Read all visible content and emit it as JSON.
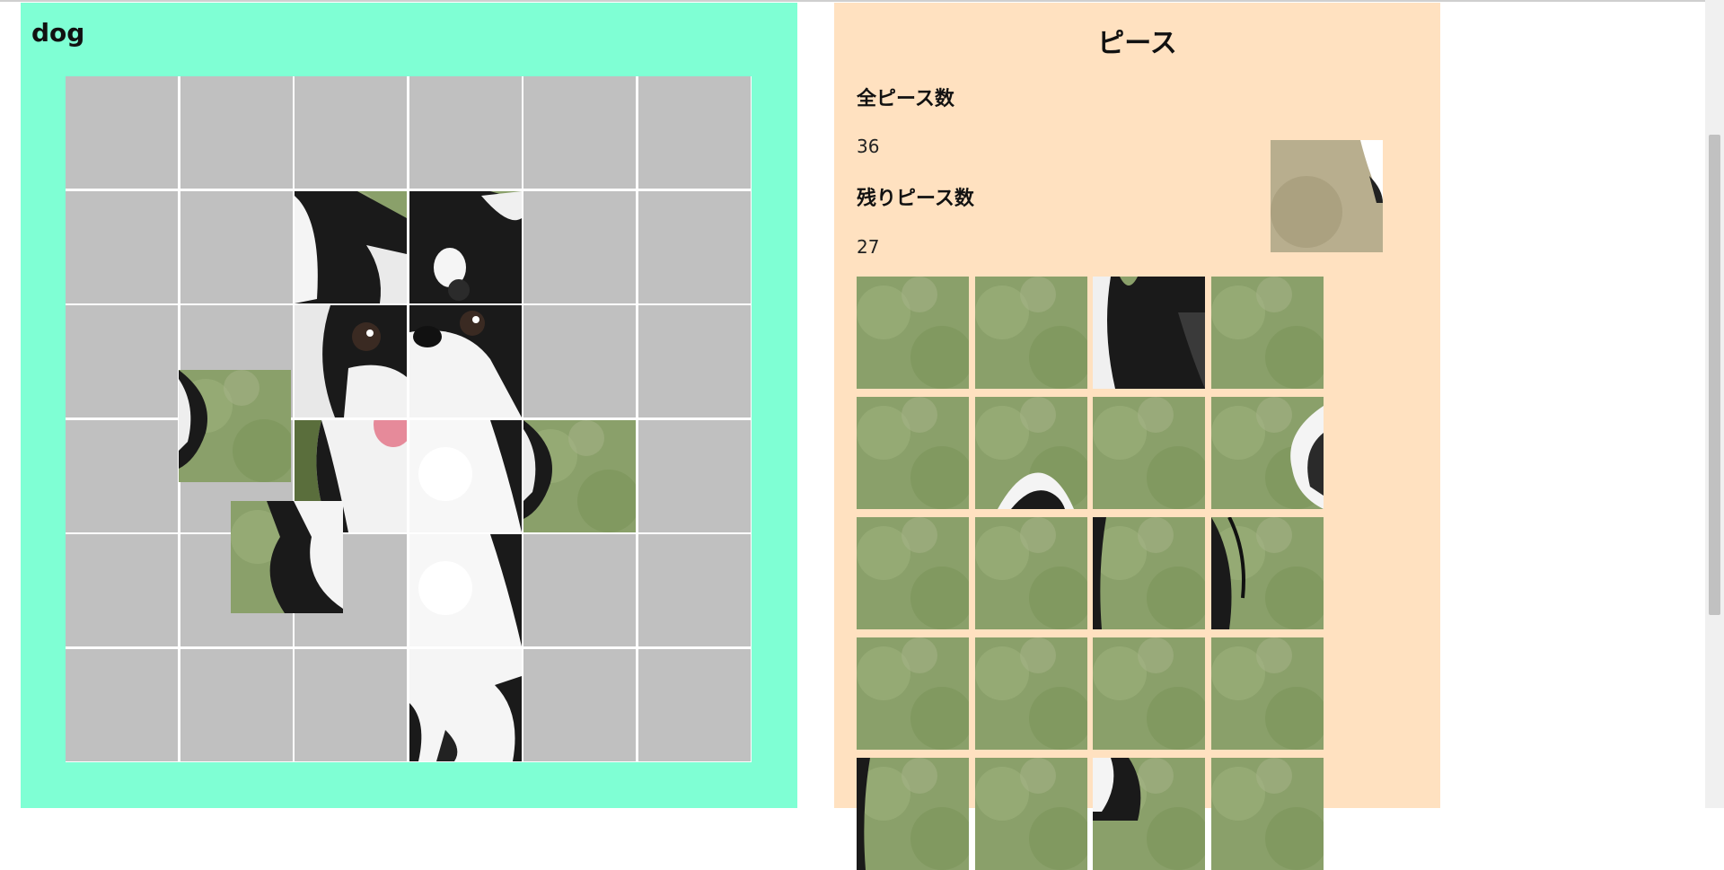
{
  "board": {
    "title": "dog",
    "grid": "6x6",
    "placed_pieces": [
      {
        "row": 1,
        "col": 2,
        "image": "dog-ear-left"
      },
      {
        "row": 1,
        "col": 3,
        "image": "dog-ear-right"
      },
      {
        "row": 2,
        "col": 2,
        "image": "dog-eye-left"
      },
      {
        "row": 2,
        "col": 3,
        "image": "dog-nose"
      },
      {
        "row": 3,
        "col": 2,
        "image": "dog-tongue-chest"
      },
      {
        "row": 3,
        "col": 3,
        "image": "dog-chest-white"
      },
      {
        "row": 3,
        "col": 4,
        "image": "dog-fur-edge-grass"
      },
      {
        "row": 4,
        "col": 3,
        "image": "dog-chest-white"
      },
      {
        "row": 5,
        "col": 3,
        "image": "dog-legs"
      }
    ],
    "loose_pieces": [
      {
        "image": "dog-fur-edge-grass"
      },
      {
        "image": "dog-fur-black-white"
      }
    ]
  },
  "pieces_panel": {
    "heading": "ピース",
    "total_label": "全ピース数",
    "total_count": "36",
    "remaining_label": "残りピース数",
    "remaining_count": "27",
    "held_piece": {
      "image": "grass-fur-edge"
    },
    "tray_columns": 4,
    "tray": [
      "grass",
      "grass",
      "dog-ear-tip",
      "grass",
      "grass",
      "grass-fur-bottom",
      "grass",
      "grass-fur-right",
      "grass",
      "grass",
      "grass-black-edge",
      "grass-black-hair",
      "grass",
      "grass",
      "grass",
      "grass",
      "grass-black-edge",
      "grass",
      "dog-fur-partial",
      "grass"
    ]
  },
  "colors": {
    "board_bg": "#7fffd4",
    "panel_bg": "#ffe1c0",
    "empty_cell": "#c0c0c0",
    "grass": "#8aa06a"
  }
}
